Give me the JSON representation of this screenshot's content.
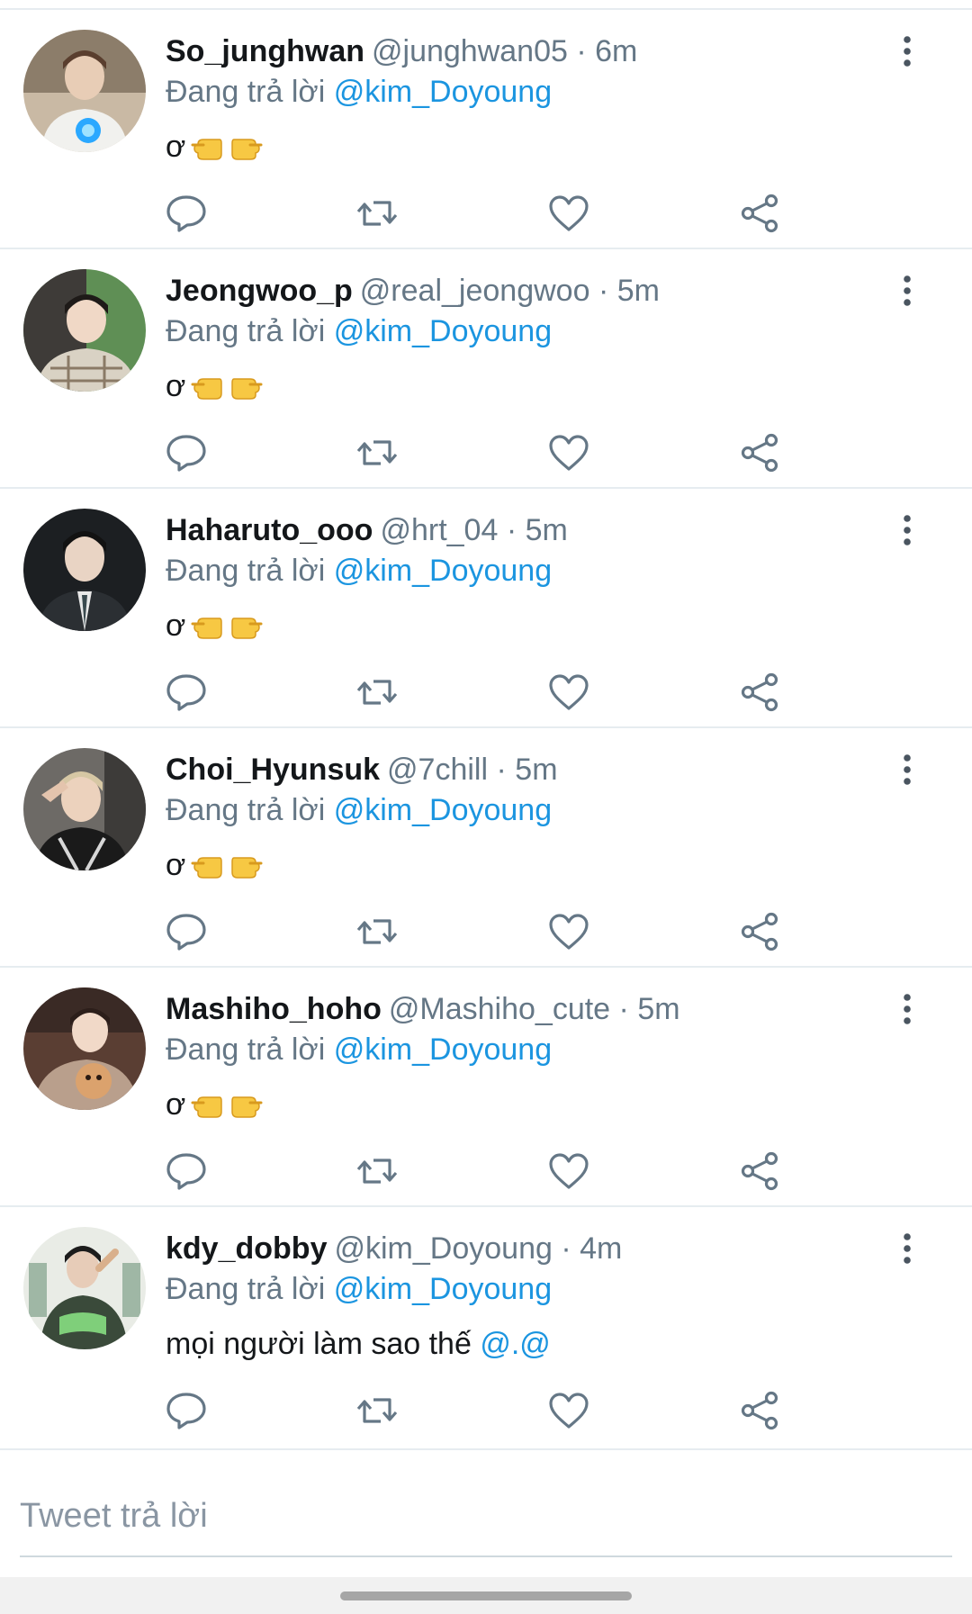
{
  "tweets": [
    {
      "display_name": "So_junghwan",
      "handle": "@junghwan05",
      "separator": "·",
      "time": "6m",
      "reply_prefix": "Đang trả lời",
      "reply_to": "@kim_Doyoung",
      "text": "ơ",
      "emoji": "point-right-emoji"
    },
    {
      "display_name": "Jeongwoo_p",
      "handle": "@real_jeongwoo",
      "separator": "·",
      "time": "5m",
      "reply_prefix": "Đang trả lời",
      "reply_to": "@kim_Doyoung",
      "text": "ơ",
      "emoji": "point-right-emoji"
    },
    {
      "display_name": "Haharuto_ooo",
      "handle": "@hrt_04",
      "separator": "·",
      "time": "5m",
      "reply_prefix": "Đang trả lời",
      "reply_to": "@kim_Doyoung",
      "text": "ơ",
      "emoji": "point-right-emoji"
    },
    {
      "display_name": "Choi_Hyunsuk",
      "handle": "@7chill",
      "separator": "·",
      "time": "5m",
      "reply_prefix": "Đang trả lời",
      "reply_to": "@kim_Doyoung",
      "text": "ơ",
      "emoji": "point-right-emoji"
    },
    {
      "display_name": "Mashiho_hoho",
      "handle": "@Mashiho_cute",
      "separator": "·",
      "time": "5m",
      "reply_prefix": "Đang trả lời",
      "reply_to": "@kim_Doyoung",
      "text": "ơ",
      "emoji": "point-right-emoji"
    },
    {
      "display_name": "kdy_dobby",
      "handle": "@kim_Doyoung",
      "separator": "·",
      "time": "4m",
      "reply_prefix": "Đang trả lời",
      "reply_to": "@kim_Doyoung",
      "text": "mọi người làm sao thế",
      "mention_text": "@.@"
    }
  ],
  "actions": {
    "icons": [
      "reply-icon",
      "retweet-icon",
      "like-icon",
      "share-icon"
    ]
  },
  "composer": {
    "placeholder": "Tweet trả lời"
  },
  "colors": {
    "mention": "#1b95e0",
    "secondary_text": "#657786",
    "icon": "#657786",
    "divider": "#e6ecf0"
  }
}
